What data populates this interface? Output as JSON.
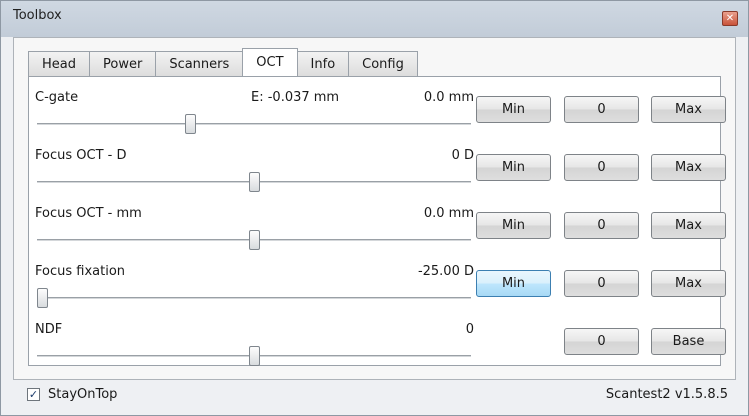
{
  "window": {
    "title": "Toolbox",
    "close_glyph": "✕"
  },
  "tabs": [
    "Head",
    "Power",
    "Scanners",
    "OCT",
    "Info",
    "Config"
  ],
  "active_tab": "OCT",
  "rows": [
    {
      "label": "C-gate",
      "extra": "E: -0.037 mm",
      "value": "0.0 mm",
      "slider_fraction": 0.35,
      "buttons": [
        "Min",
        "0",
        "Max"
      ]
    },
    {
      "label": "Focus OCT - D",
      "value": "0 D",
      "slider_fraction": 0.5,
      "buttons": [
        "Min",
        "0",
        "Max"
      ]
    },
    {
      "label": "Focus OCT - mm",
      "value": "0.0 mm",
      "slider_fraction": 0.5,
      "buttons": [
        "Min",
        "0",
        "Max"
      ]
    },
    {
      "label": "Focus fixation",
      "value": "-25.00 D",
      "slider_fraction": 0.0,
      "buttons": [
        "Min",
        "0",
        "Max"
      ],
      "hover_button": "Min"
    },
    {
      "label": "NDF",
      "value": "0",
      "slider_fraction": 0.5,
      "buttons": [
        "0",
        "Base"
      ]
    }
  ],
  "footer": {
    "stay_on_top_label": "StayOnTop",
    "stay_on_top_checked": true,
    "check_glyph": "✓",
    "version": "Scantest2 v1.5.8.5"
  }
}
